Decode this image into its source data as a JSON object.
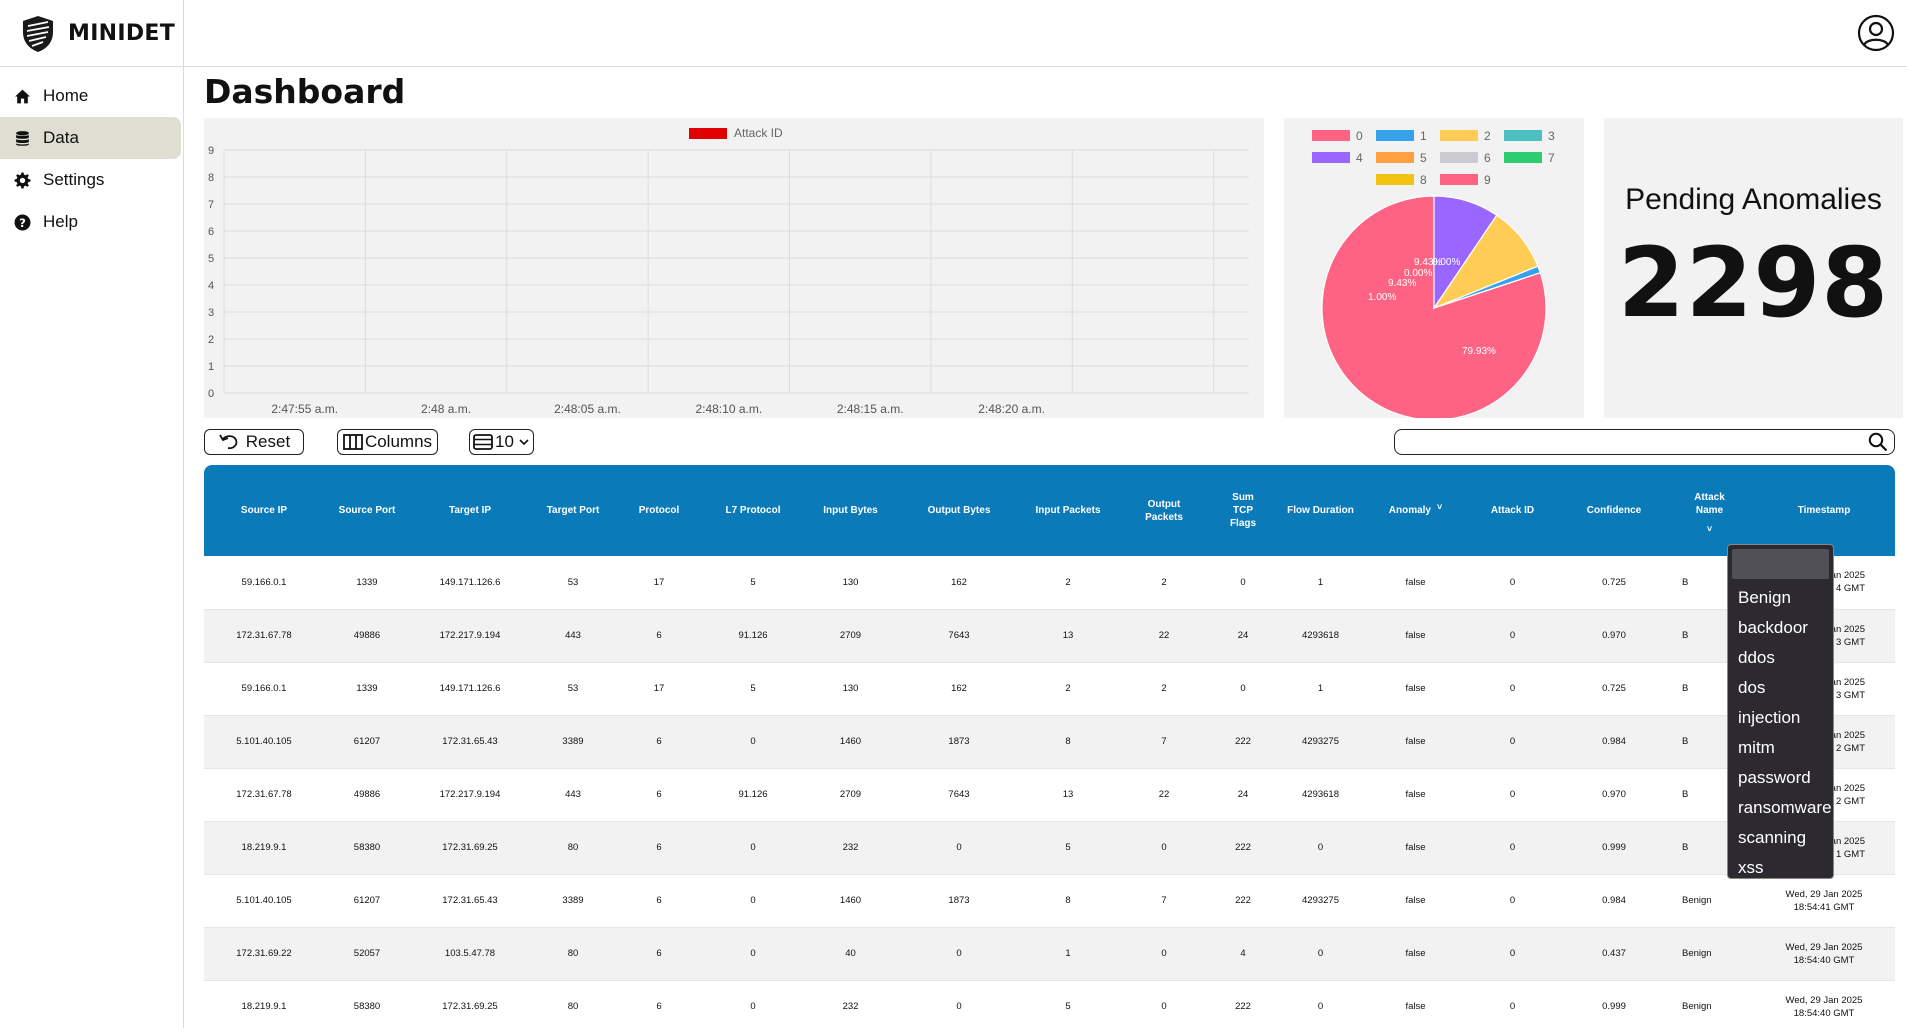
{
  "app": {
    "name": "MINIDET"
  },
  "sidebar": {
    "items": [
      {
        "label": "Home",
        "icon": "home-icon"
      },
      {
        "label": "Data",
        "icon": "database-icon",
        "active": true
      },
      {
        "label": "Settings",
        "icon": "gear-icon"
      },
      {
        "label": "Help",
        "icon": "help-icon"
      }
    ]
  },
  "page": {
    "title": "Dashboard"
  },
  "line_chart": {
    "legend": "Attack ID",
    "legend_color": "#e00000",
    "y_ticks": [
      "0",
      "1",
      "2",
      "3",
      "4",
      "5",
      "6",
      "7",
      "8",
      "9"
    ],
    "x_ticks": [
      "2:47:55 a.m.",
      "2:48 a.m.",
      "2:48:05 a.m.",
      "2:48:10 a.m.",
      "2:48:15 a.m.",
      "2:48:20 a.m."
    ]
  },
  "chart_data": [
    {
      "type": "line",
      "legend": [
        "Attack ID"
      ],
      "x": [
        "2:47:55 a.m.",
        "2:48 a.m.",
        "2:48:05 a.m.",
        "2:48:10 a.m.",
        "2:48:15 a.m.",
        "2:48:20 a.m."
      ],
      "ylim": [
        0,
        9
      ],
      "series": [
        {
          "name": "Attack ID",
          "values": []
        }
      ],
      "grid": true,
      "legend_placement": "top"
    },
    {
      "type": "pie",
      "categories": [
        "0",
        "1",
        "2",
        "3",
        "4",
        "5",
        "6",
        "7",
        "8",
        "9"
      ],
      "colors": [
        "#ff6384",
        "#36a2eb",
        "#ffcd56",
        "#4bc0c0",
        "#9966ff",
        "#ff9f40",
        "#c9cbcf",
        "#2ecc71",
        "#f1c40f",
        "#ff6384"
      ],
      "values": [
        79.93,
        1.0,
        9.43,
        0.0,
        9.43,
        0.0,
        0.0,
        0.0,
        0.0,
        0.0
      ],
      "slice_labels": [
        {
          "text": "79.93%",
          "category": "0"
        },
        {
          "text": "1.00%",
          "category": "1"
        },
        {
          "text": "9.43%",
          "category": "2"
        },
        {
          "text": "0.00%",
          "category": "3"
        },
        {
          "text": "9.43%",
          "category": "4"
        },
        {
          "text": "0.00%",
          "category": "5"
        }
      ],
      "legend_placement": "top"
    }
  ],
  "pending": {
    "label": "Pending Anomalies",
    "value": "2298"
  },
  "toolbar": {
    "reset_label": "Reset",
    "columns_label": "Columns",
    "page_size": "10",
    "search_value": ""
  },
  "table": {
    "columns": [
      "Source IP",
      "Source Port",
      "Target IP",
      "Target Port",
      "Protocol",
      "L7 Protocol",
      "Input Bytes",
      "Output Bytes",
      "Input Packets",
      "Output Packets",
      "Sum TCP Flags",
      "Flow Duration",
      "Anomaly",
      "Attack ID",
      "Confidence",
      "Attack Name",
      "Timestamp"
    ],
    "rows": [
      [
        "59.166.0.1",
        "1339",
        "149.171.126.6",
        "53",
        "17",
        "5",
        "130",
        "162",
        "2",
        "2",
        "0",
        "1",
        "false",
        "0",
        "0.725",
        "B",
        "Jan 2025",
        "4 GMT"
      ],
      [
        "172.31.67.78",
        "49886",
        "172.217.9.194",
        "443",
        "6",
        "91.126",
        "2709",
        "7643",
        "13",
        "22",
        "24",
        "4293618",
        "false",
        "0",
        "0.970",
        "B",
        "Jan 2025",
        "3 GMT"
      ],
      [
        "59.166.0.1",
        "1339",
        "149.171.126.6",
        "53",
        "17",
        "5",
        "130",
        "162",
        "2",
        "2",
        "0",
        "1",
        "false",
        "0",
        "0.725",
        "B",
        "Jan 2025",
        "3 GMT"
      ],
      [
        "5.101.40.105",
        "61207",
        "172.31.65.43",
        "3389",
        "6",
        "0",
        "1460",
        "1873",
        "8",
        "7",
        "222",
        "4293275",
        "false",
        "0",
        "0.984",
        "B",
        "Jan 2025",
        "2 GMT"
      ],
      [
        "172.31.67.78",
        "49886",
        "172.217.9.194",
        "443",
        "6",
        "91.126",
        "2709",
        "7643",
        "13",
        "22",
        "24",
        "4293618",
        "false",
        "0",
        "0.970",
        "B",
        "Jan 2025",
        "2 GMT"
      ],
      [
        "18.219.9.1",
        "58380",
        "172.31.69.25",
        "80",
        "6",
        "0",
        "232",
        "0",
        "5",
        "0",
        "222",
        "0",
        "false",
        "0",
        "0.999",
        "B",
        "Jan 2025",
        "1 GMT"
      ],
      [
        "5.101.40.105",
        "61207",
        "172.31.65.43",
        "3389",
        "6",
        "0",
        "1460",
        "1873",
        "8",
        "7",
        "222",
        "4293275",
        "false",
        "0",
        "0.984",
        "Benign",
        "Wed, 29 Jan 2025",
        "18:54:41 GMT"
      ],
      [
        "172.31.69.22",
        "52057",
        "103.5.47.78",
        "80",
        "6",
        "0",
        "40",
        "0",
        "1",
        "0",
        "4",
        "0",
        "false",
        "0",
        "0.437",
        "Benign",
        "Wed, 29 Jan 2025",
        "18:54:40 GMT"
      ],
      [
        "18.219.9.1",
        "58380",
        "172.31.69.25",
        "80",
        "6",
        "0",
        "232",
        "0",
        "5",
        "0",
        "222",
        "0",
        "false",
        "0",
        "0.999",
        "Benign",
        "Wed, 29 Jan 2025",
        "18:54:40 GMT"
      ]
    ]
  },
  "attack_filter": {
    "options": [
      "Benign",
      "backdoor",
      "ddos",
      "dos",
      "injection",
      "mitm",
      "password",
      "ransomware",
      "scanning",
      "xss"
    ]
  }
}
